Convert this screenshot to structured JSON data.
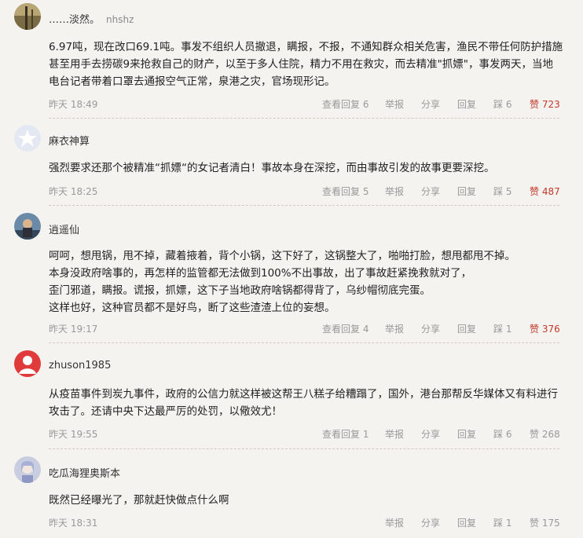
{
  "comments": [
    {
      "user": "……淡然。",
      "sub": "nhshz",
      "lines": [
        "6.97吨，现在改口69.1吨。事发不组织人员撤退，瞒报，不报，不通知群众相关危害，渔民不带任何防护措施",
        "甚至用手去捞碳9来抢救自己的财产，以至于多人住院，精力不用在救灾，而去精准\"抓嫖\"，事发两天，当地",
        "电台记者带着口罩去通报空气正常，泉港之灾，官场现形记。"
      ],
      "time": "昨天 18:49",
      "view_replies": "查看回复 6",
      "report": "举报",
      "share": "分享",
      "reply": "回复",
      "dislike": "踩 6",
      "like": "赞 723"
    },
    {
      "user": "麻衣神算",
      "sub": "",
      "lines": [
        "强烈要求还那个被精准“抓嫖“的女记者清白！事故本身在深挖，而由事故引发的故事更要深挖。"
      ],
      "time": "昨天 18:25",
      "view_replies": "查看回复 5",
      "report": "举报",
      "share": "分享",
      "reply": "回复",
      "dislike": "踩 5",
      "like": "赞 487"
    },
    {
      "user": "逍遥仙",
      "sub": "",
      "lines": [
        "呵呵，想甩锅，甩不掉，藏着掖着，背个小锅，这下好了，这锅整大了，啪啪打脸，想甩都甩不掉。",
        "本身没政府啥事的，再怎样的监管都无法做到100%不出事故，出了事故赶紧挽救就对了，",
        "歪门邪道，瞒报。谎报，抓嫖，这下子当地政府啥锅都得背了，乌纱帽彻底完蛋。",
        "这样也好，这种官员都不是好鸟，断了这些渣渣上位的妄想。"
      ],
      "time": "昨天 19:17",
      "view_replies": "查看回复 4",
      "report": "举报",
      "share": "分享",
      "reply": "回复",
      "dislike": "踩 1",
      "like": "赞 376"
    },
    {
      "user": "zhuson1985",
      "sub": "",
      "lines": [
        "从疫苗事件到炭九事件，政府的公信力就这样被这帮王八糕子给糟蹋了，国外，港台那帮反华媒体又有料进行",
        "攻击了。还请中央下达最严厉的处罚，以儆效尤！"
      ],
      "time": "昨天 19:55",
      "view_replies": "查看回复 1",
      "report": "举报",
      "share": "分享",
      "reply": "回复",
      "dislike": "踩 6",
      "like": "赞 268"
    },
    {
      "user": "吃瓜海狸奥斯本",
      "sub": "",
      "lines": [
        "既然已经曝光了，那就赶快做点什么啊"
      ],
      "time": "昨天 18:31",
      "report": "举报",
      "share": "分享",
      "reply": "回复",
      "dislike": "踩 1",
      "like": "赞 175"
    }
  ]
}
